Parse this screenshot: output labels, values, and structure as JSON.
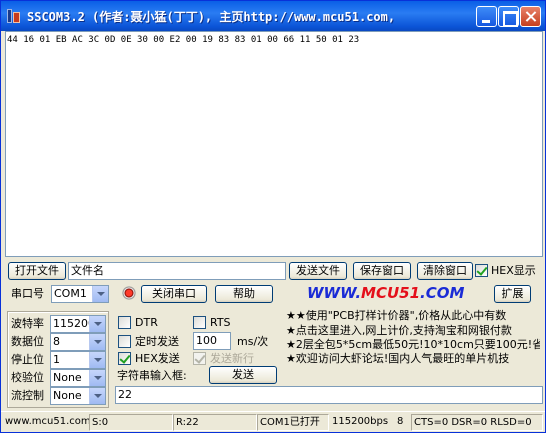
{
  "window": {
    "title": "SSCOM3.2 (作者:聂小猛(丁丁), 主页http://www.mcu51.com,"
  },
  "receive": {
    "text": "44 16 01 EB AC 3C 0D 0E 30 00 E2 00 19 83 83 01 00 66 11 50 01 23"
  },
  "file_row": {
    "open_file": "打开文件",
    "filename": "文件名",
    "send_file": "发送文件",
    "save_window": "保存窗口",
    "clear_window": "清除窗口",
    "hex_display": "HEX显示",
    "hex_display_checked": true
  },
  "port_row": {
    "port_label": "串口号",
    "port_value": "COM1",
    "close_port": "关闭串口",
    "help": "帮助",
    "logo_left": "WWW.",
    "logo_mid": "MCU51",
    "logo_right": ".COM",
    "expand": "扩展"
  },
  "settings": {
    "baud_label": "波特率",
    "baud_value": "115200",
    "databits_label": "数据位",
    "databits_value": "8",
    "stopbits_label": "停止位",
    "stopbits_value": "1",
    "parity_label": "校验位",
    "parity_value": "None",
    "flow_label": "流控制",
    "flow_value": "None"
  },
  "send_options": {
    "dtr": "DTR",
    "rts": "RTS",
    "timed_send": "定时发送",
    "interval": "100",
    "interval_unit": "ms/次",
    "hex_send": "HEX发送",
    "hex_send_checked": true,
    "send_newline": "发送新行",
    "input_label": "字符串输入框:",
    "send": "发送",
    "input_value": "22"
  },
  "ads": [
    "★★使用\"PCB打样计价器\",价格从此心中有数",
    "★点击这里进入,网上计价,支持淘宝和网银付款",
    "★2层全包5*5cm最低50元!10*10cm只要100元!省",
    "★欢迎访问大虾论坛!国内人气最旺的单片机技"
  ],
  "status": {
    "site": "www.mcu51.com",
    "sent": "S:0",
    "received": "R:22",
    "port_state": "COM1已打开",
    "baud": "115200bps",
    "bits": "8",
    "lines": "CTS=0 DSR=0 RLSD=0"
  },
  "colors": {
    "titlebar": "#0a5fe6",
    "logo_blue": "#1a2bd6",
    "logo_red": "#e4101a"
  }
}
